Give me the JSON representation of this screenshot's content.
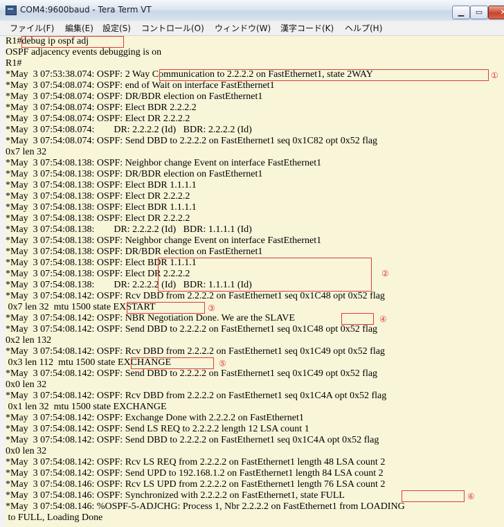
{
  "window": {
    "title": "COM4:9600baud - Tera Term VT",
    "buttons": {
      "minimize": "▁",
      "maximize": "▭",
      "close": "✕"
    }
  },
  "menu": [
    "ファイル(F)",
    "編集(E)",
    "設定(S)",
    "コントロール(O)",
    "ウィンドウ(W)",
    "漢字コード(K)",
    "ヘルプ(H)"
  ],
  "terminal": {
    "lines": [
      "R1#debug ip ospf adj",
      "OSPF adjacency events debugging is on",
      "R1#",
      "*May  3 07:53:38.074: OSPF: 2 Way Communication to 2.2.2.2 on FastEthernet1, state 2WAY",
      "*May  3 07:54:08.074: OSPF: end of Wait on interface FastEthernet1",
      "*May  3 07:54:08.074: OSPF: DR/BDR election on FastEthernet1",
      "*May  3 07:54:08.074: OSPF: Elect BDR 2.2.2.2",
      "*May  3 07:54:08.074: OSPF: Elect DR 2.2.2.2",
      "*May  3 07:54:08.074:        DR: 2.2.2.2 (Id)   BDR: 2.2.2.2 (Id)",
      "*May  3 07:54:08.074: OSPF: Send DBD to 2.2.2.2 on FastEthernet1 seq 0x1C82 opt 0x52 flag",
      "0x7 len 32",
      "*May  3 07:54:08.138: OSPF: Neighbor change Event on interface FastEthernet1",
      "*May  3 07:54:08.138: OSPF: DR/BDR election on FastEthernet1",
      "*May  3 07:54:08.138: OSPF: Elect BDR 1.1.1.1",
      "*May  3 07:54:08.138: OSPF: Elect DR 2.2.2.2",
      "*May  3 07:54:08.138: OSPF: Elect BDR 1.1.1.1",
      "*May  3 07:54:08.138: OSPF: Elect DR 2.2.2.2",
      "*May  3 07:54:08.138:        DR: 2.2.2.2 (Id)   BDR: 1.1.1.1 (Id)",
      "*May  3 07:54:08.138: OSPF: Neighbor change Event on interface FastEthernet1",
      "*May  3 07:54:08.138: OSPF: DR/BDR election on FastEthernet1",
      "*May  3 07:54:08.138: OSPF: Elect BDR 1.1.1.1",
      "*May  3 07:54:08.138: OSPF: Elect DR 2.2.2.2",
      "*May  3 07:54:08.138:        DR: 2.2.2.2 (Id)   BDR: 1.1.1.1 (Id)",
      "*May  3 07:54:08.142: OSPF: Rcv DBD from 2.2.2.2 on FastEthernet1 seq 0x1C48 opt 0x52 flag",
      " 0x7 len 32  mtu 1500 state EXSTART",
      "*May  3 07:54:08.142: OSPF: NBR Negotiation Done. We are the SLAVE",
      "*May  3 07:54:08.142: OSPF: Send DBD to 2.2.2.2 on FastEthernet1 seq 0x1C48 opt 0x52 flag",
      "0x2 len 132",
      "*May  3 07:54:08.142: OSPF: Rcv DBD from 2.2.2.2 on FastEthernet1 seq 0x1C49 opt 0x52 flag",
      " 0x3 len 112  mtu 1500 state EXCHANGE",
      "*May  3 07:54:08.142: OSPF: Send DBD to 2.2.2.2 on FastEthernet1 seq 0x1C49 opt 0x52 flag",
      "0x0 len 32",
      "*May  3 07:54:08.142: OSPF: Rcv DBD from 2.2.2.2 on FastEthernet1 seq 0x1C4A opt 0x52 flag",
      " 0x1 len 32  mtu 1500 state EXCHANGE",
      "*May  3 07:54:08.142: OSPF: Exchange Done with 2.2.2.2 on FastEthernet1",
      "*May  3 07:54:08.142: OSPF: Send LS REQ to 2.2.2.2 length 12 LSA count 1",
      "*May  3 07:54:08.142: OSPF: Send DBD to 2.2.2.2 on FastEthernet1 seq 0x1C4A opt 0x52 flag",
      "0x0 len 32",
      "*May  3 07:54:08.142: OSPF: Rcv LS REQ from 2.2.2.2 on FastEthernet1 length 48 LSA count 2",
      "*May  3 07:54:08.142: OSPF: Send UPD to 192.168.1.2 on FastEthernet1 length 84 LSA count 2",
      "*May  3 07:54:08.146: OSPF: Rcv LS UPD from 2.2.2.2 on FastEthernet1 length 76 LSA count 2",
      "*May  3 07:54:08.146: OSPF: Synchronized with 2.2.2.2 on FastEthernet1, state FULL",
      "*May  3 07:54:08.146: %OSPF-5-ADJCHG: Process 1, Nbr 2.2.2.2 on FastEthernet1 from LOADING",
      " to FULL, Loading Done"
    ],
    "annotations": [
      "①",
      "②",
      "③",
      "④",
      "⑤",
      "⑥"
    ],
    "highlight_color": "#e03b3b",
    "background_color": "#f8f5d9"
  }
}
